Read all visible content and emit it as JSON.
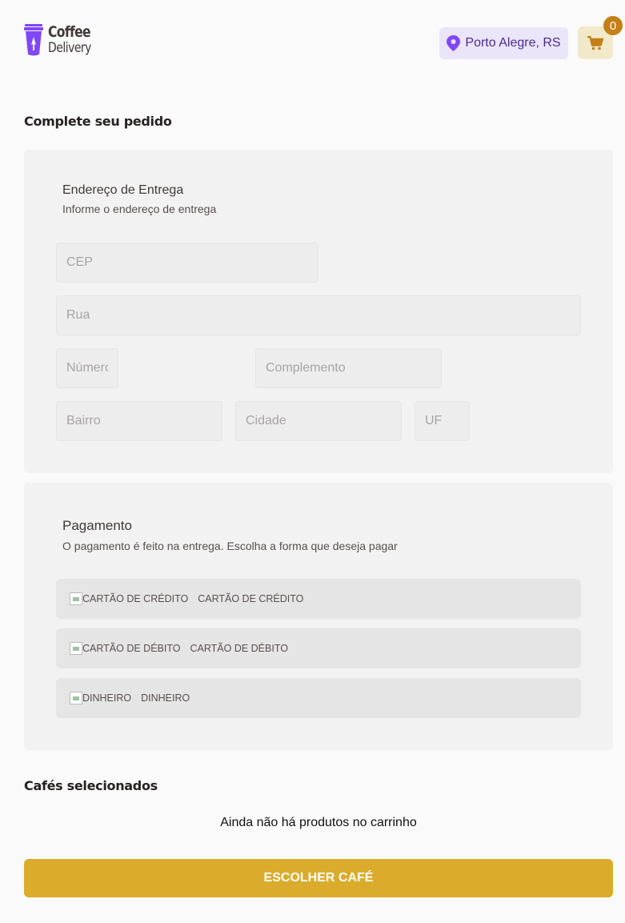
{
  "header": {
    "logo_line1": "Coffee",
    "logo_line2": "Delivery",
    "location": "Porto Alegre, RS",
    "cart_count": "0",
    "colors": {
      "purple": "#8047f8",
      "purple_dark": "#4b2995",
      "yellow": "#dbac2c",
      "yellow_dark": "#c47f17"
    }
  },
  "page_title": "Complete seu pedido",
  "address": {
    "title": "Endereço de Entrega",
    "subtitle": "Informe o endereço de entrega",
    "cep_placeholder": "CEP",
    "rua_placeholder": "Rua",
    "numero_placeholder": "Número",
    "complemento_placeholder": "Complemento",
    "bairro_placeholder": "Bairro",
    "cidade_placeholder": "Cidade",
    "uf_placeholder": "UF"
  },
  "payment": {
    "title": "Pagamento",
    "subtitle": "O pagamento é feito na entrega. Escolha a forma que deseja pagar",
    "options": [
      {
        "alt": "CARTÃO DE CRÉDITO",
        "label": "CARTÃO DE CRÉDITO"
      },
      {
        "alt": "CARTÃO DE DÉBITO",
        "label": "CARTÃO DE DÉBITO"
      },
      {
        "alt": "DINHEIRO",
        "label": "DINHEIRO"
      }
    ]
  },
  "selected": {
    "title": "Cafés selecionados",
    "empty_text": "Ainda não há produtos no carrinho",
    "cta_label": "ESCOLHER CAFÉ"
  }
}
